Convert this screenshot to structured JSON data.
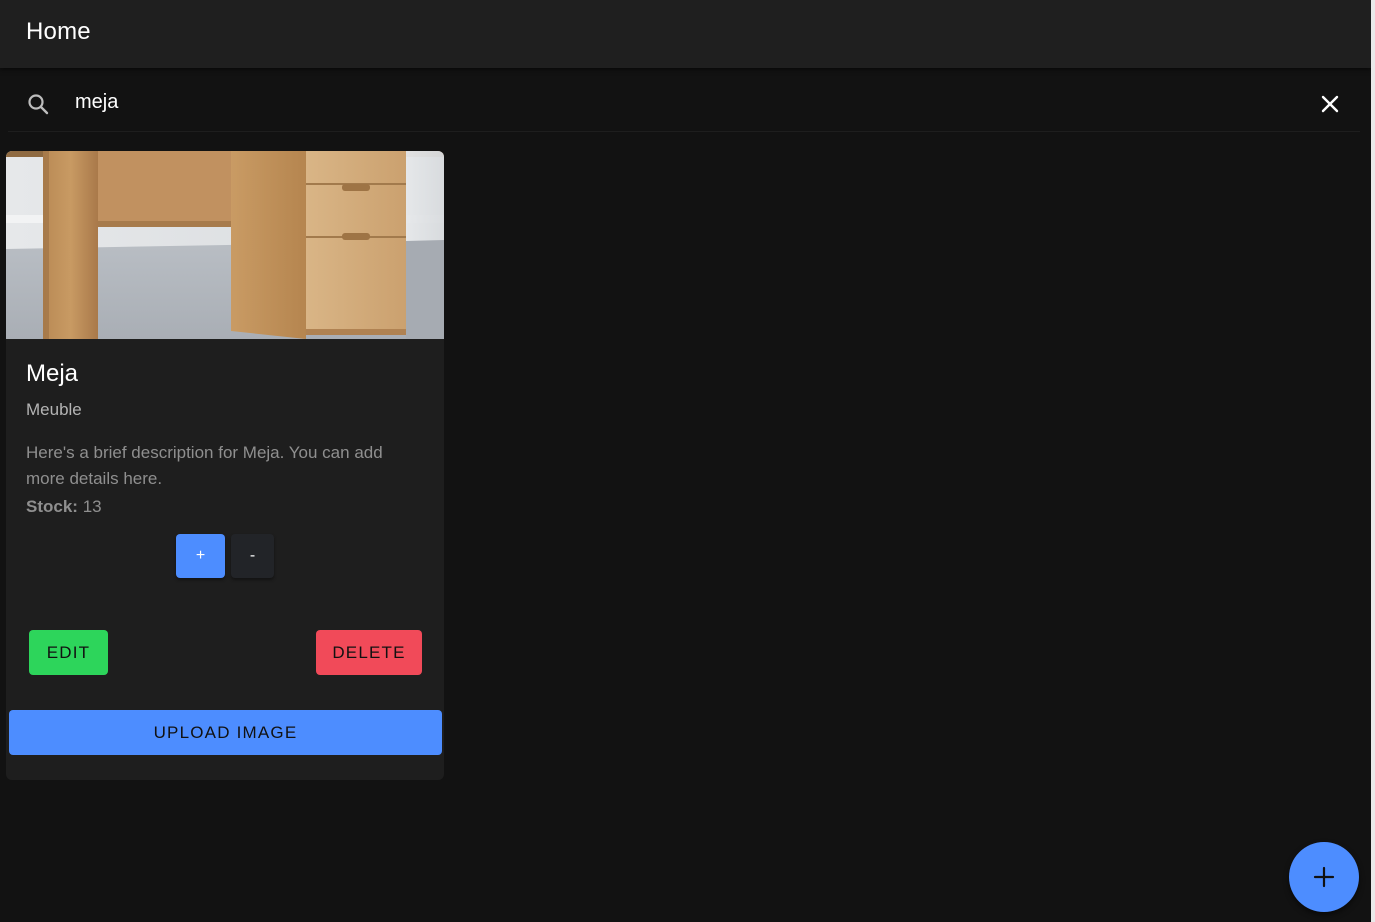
{
  "toolbar": {
    "title": "Home"
  },
  "search": {
    "value": "meja",
    "search_icon": "search-icon",
    "clear_icon": "close-icon"
  },
  "card": {
    "image_alt": "wooden desk with drawers",
    "title": "Meja",
    "subtitle": "Meuble",
    "description": "Here's a brief description for Meja. You can add more details here.",
    "stock_label": "Stock:",
    "stock_value": "13",
    "plus_label": "+",
    "minus_label": "-",
    "edit_label": "EDIT",
    "delete_label": "DELETE",
    "upload_label": "UPLOAD IMAGE"
  },
  "fab": {
    "icon": "plus-icon"
  },
  "colors": {
    "background": "#121212",
    "toolbar": "#1f1f1f",
    "card": "#1e1e1e",
    "primary": "#4d8dff",
    "success": "#2dd55b",
    "danger": "#f14a59"
  }
}
